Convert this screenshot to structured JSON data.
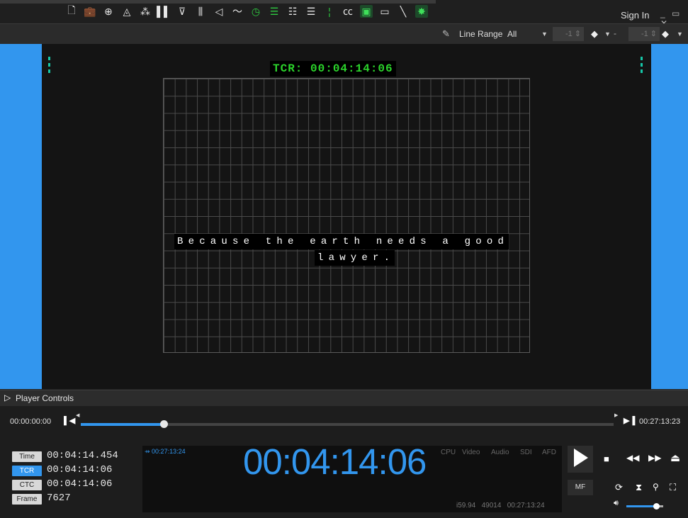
{
  "topbar": {
    "icons": [
      "new-file-icon",
      "briefcase-icon",
      "add-circle-icon",
      "navigate-icon",
      "waveform-splat-icon",
      "bars-icon",
      "vector-icon",
      "mixer-icon",
      "audio-out-icon",
      "pulse-icon",
      "clock-icon",
      "list-icon",
      "subtitle-list-icon",
      "format-icon",
      "info-icon",
      "cc-icon",
      "terminal-icon",
      "comment-icon",
      "pen-tool-icon",
      "settings-green-icon"
    ],
    "sign_in": "Sign In",
    "window_controls": "_ ▭ ✕"
  },
  "toolbar2": {
    "line_range_label": "Line Range",
    "line_range_value": "All",
    "spin1": "-1",
    "spin2": "-1",
    "dash": "-"
  },
  "video": {
    "tcr_overlay": "TCR: 00:04:14:06",
    "caption_line1": "Because the earth needs a good",
    "caption_line2": "lawyer."
  },
  "player": {
    "section_label": "Player Controls",
    "start_time": "00:00:00:00",
    "end_time": "00:27:13:23",
    "progress": 0.156
  },
  "timecodes": [
    {
      "label": "Time",
      "value": "00:04:14.454",
      "active": false
    },
    {
      "label": "TCR",
      "value": "00:04:14:06",
      "active": true
    },
    {
      "label": "CTC",
      "value": "00:04:14:06",
      "active": false
    },
    {
      "label": "Frame",
      "value": "7627",
      "active": false
    }
  ],
  "display": {
    "duration": "00:27:13:24",
    "big_timecode": "00:04:14:06",
    "status_items": [
      "CPU",
      "Video",
      "Audio",
      "SDI",
      "AFD"
    ],
    "info": "i59.94   49014   00:27:13:24"
  },
  "transport": {
    "mf_label": "MF",
    "volume": 0.8
  },
  "colors": {
    "accent": "#3296ee",
    "green": "#2bd42b",
    "teal": "#16c7a8"
  }
}
